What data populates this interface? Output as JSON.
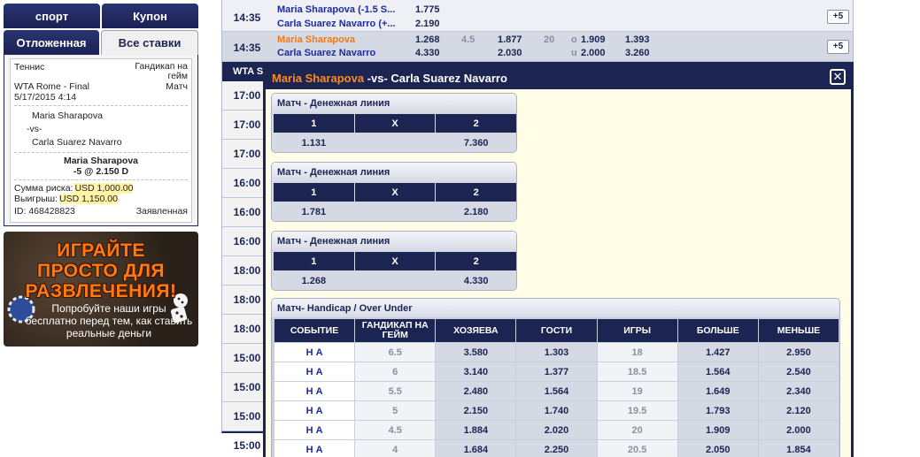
{
  "sidebar": {
    "tabs_top": [
      "спорт",
      "Купон"
    ],
    "tabs_bottom": [
      "Отложенная",
      "Все ставки"
    ],
    "slip": {
      "sport": "Теннис",
      "market": [
        "Гандикап на",
        "гейм"
      ],
      "event": "WTA Rome - Final",
      "period": "Матч",
      "date": "5/17/2015 4:14",
      "team1": "Maria Sharapova",
      "vs": "-vs-",
      "team2": "Carla Suarez Navarro",
      "selection": "Maria Sharapova",
      "line": "-5 @ 2.150 D",
      "risk_label": "Сумма риска:",
      "risk_value": "USD 1,000.00",
      "win_label": "Выигрыш:",
      "win_value": "USD 1,150.00",
      "id": "ID: 468428823",
      "status": "Заявленная"
    },
    "banner": {
      "line1": "ИГРАЙТЕ",
      "line2": "ПРОСТО ДЛЯ",
      "line3": "РАЗВЛЕЧЕНИЯ!",
      "sub": "Попробуйте наши игры бесплатно перед тем, как ставить реальные деньги"
    }
  },
  "grid": {
    "row1": {
      "time": "14:35",
      "team1": "Maria Sharapova (-1.5 S...",
      "team2": "Carla Suarez Navarro (+...",
      "odd1": "1.775",
      "odd2": "2.190",
      "more": "+5"
    },
    "row2": {
      "time": "14:35",
      "team1": "Maria Sharapova",
      "team2": "Carla Suarez Navarro",
      "ml1": "1.268",
      "ml2": "4.330",
      "hcp": "4.5",
      "hcp_odd1": "1.877",
      "hcp_odd2": "2.030",
      "total": "20",
      "o": "o",
      "u": "u",
      "ou1": "1.909",
      "ou2": "2.000",
      "x1": "1.393",
      "x2": "3.260",
      "more": "+5"
    },
    "league": "WTA S",
    "times": [
      "17:00",
      "17:00",
      "17:00",
      "16:00",
      "16:00",
      "16:00",
      "18:00",
      "18:00",
      "18:00",
      "15:00",
      "15:00",
      "15:00",
      "15:00"
    ]
  },
  "modal": {
    "title_p1": "Maria Sharapova",
    "title_rest": " -vs- Carla Suarez Navarro",
    "close": "✕",
    "moneylines": [
      {
        "title": "Матч - Денежная линия",
        "h1": "1",
        "hx": "X",
        "h2": "2",
        "v1": "1.131",
        "vx": "",
        "v2": "7.360"
      },
      {
        "title": "Матч - Денежная линия",
        "h1": "1",
        "hx": "X",
        "h2": "2",
        "v1": "1.781",
        "vx": "",
        "v2": "2.180"
      },
      {
        "title": "Матч - Денежная линия",
        "h1": "1",
        "hx": "X",
        "h2": "2",
        "v1": "1.268",
        "vx": "",
        "v2": "4.330"
      }
    ],
    "hou": {
      "title": "Матч- Handicap / Over Under",
      "headers": [
        "СОБЫТИЕ",
        "ГАНДИКАП НА ГЕЙМ",
        "ХОЗЯЕВА",
        "ГОСТИ",
        "ИГРЫ",
        "БОЛЬШЕ",
        "МЕНЬШЕ"
      ],
      "rows": [
        {
          "event": "Н А",
          "hcp": "6.5",
          "home": "3.580",
          "away": "1.303",
          "games": "18",
          "over": "1.427",
          "under": "2.950"
        },
        {
          "event": "Н А",
          "hcp": "6",
          "home": "3.140",
          "away": "1.377",
          "games": "18.5",
          "over": "1.564",
          "under": "2.540"
        },
        {
          "event": "Н А",
          "hcp": "5.5",
          "home": "2.480",
          "away": "1.564",
          "games": "19",
          "over": "1.649",
          "under": "2.340"
        },
        {
          "event": "Н А",
          "hcp": "5",
          "home": "2.150",
          "away": "1.740",
          "games": "19.5",
          "over": "1.793",
          "under": "2.120"
        },
        {
          "event": "Н А",
          "hcp": "4.5",
          "home": "1.884",
          "away": "2.020",
          "games": "20",
          "over": "1.909",
          "under": "2.000"
        },
        {
          "event": "Н А",
          "hcp": "4",
          "home": "1.684",
          "away": "2.250",
          "games": "20.5",
          "over": "2.050",
          "under": "1.854"
        }
      ]
    }
  }
}
